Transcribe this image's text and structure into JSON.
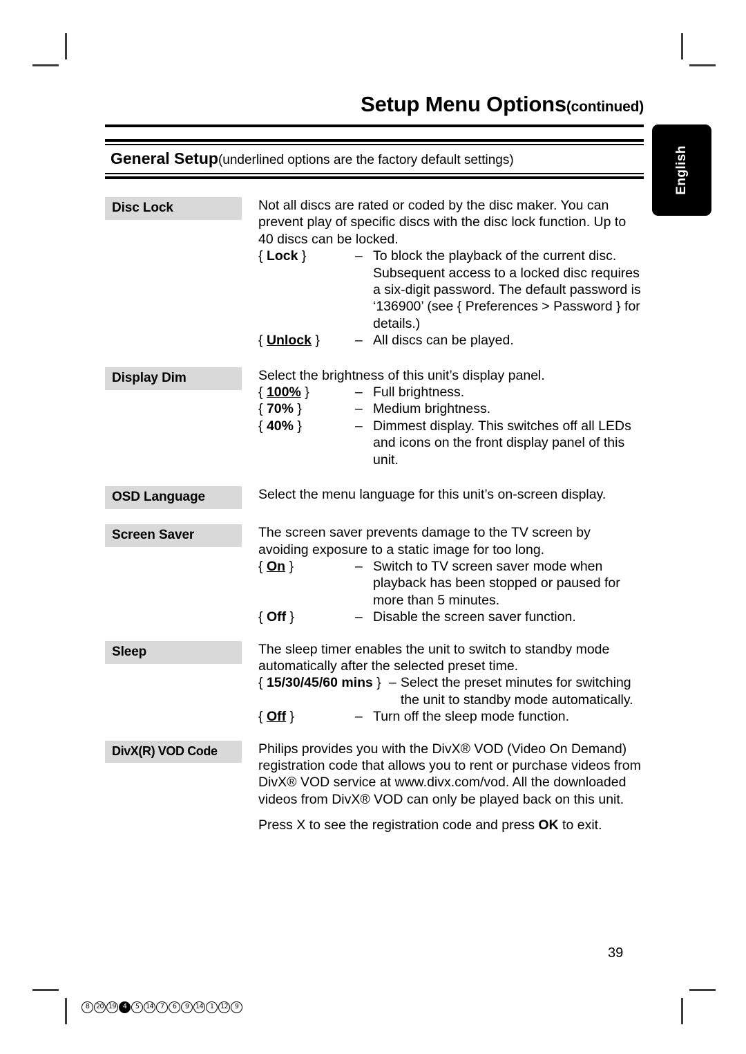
{
  "document": {
    "header_title": "Setup Menu Options",
    "header_continued": "(continued)",
    "section_name": "General Setup",
    "section_note": "(underlined options are the factory default settings)",
    "page_number": "39",
    "side_tab_label": "English"
  },
  "colors": {
    "term_background": "#d9d9d9",
    "rule": "#000000",
    "side_tab_background": "#000000",
    "side_tab_text": "#ffffff",
    "crop_mark": "#3b3b3b"
  },
  "entries": {
    "disc_lock": {
      "term": "Disc Lock",
      "intro": "Not all discs are rated or coded by the disc maker. You can prevent play of specific discs with the disc lock function. Up to 40 discs can be locked.",
      "options": [
        {
          "key_open": "{ ",
          "key": "Lock",
          "key_close": " }",
          "dash": "–",
          "text": "To block the playback of the current disc. Subsequent access to a locked disc requires a six-digit password.  The default password is ‘136900’ (see { Preferences > Password } for details.)"
        },
        {
          "key_open": "{ ",
          "key": "Unlock",
          "key_close": " }",
          "dash": "–",
          "text": "All discs can be played."
        }
      ]
    },
    "display_dim": {
      "term": "Display Dim",
      "intro": "Select the brightness of this unit’s display panel.",
      "options": [
        {
          "key_open": "{ ",
          "key": "100%",
          "key_close": " }",
          "dash": "–",
          "text": "Full brightness."
        },
        {
          "key_open": "{ ",
          "key": "70%",
          "key_close": " }",
          "dash": "–",
          "text": "Medium brightness."
        },
        {
          "key_open": "{ ",
          "key": "40%",
          "key_close": " }",
          "dash": "–",
          "text": "Dimmest display.  This switches off all LEDs and icons on the front display panel of this unit."
        }
      ]
    },
    "osd_language": {
      "term": "OSD Language",
      "intro": "Select the menu language for this unit’s on-screen display."
    },
    "screen_saver": {
      "term": "Screen Saver",
      "intro": "The screen saver prevents damage to the TV screen by avoiding exposure to a static image for too long.",
      "options": [
        {
          "key_open": "{ ",
          "key": "On",
          "key_close": " }",
          "dash": "–",
          "text": "Switch to TV screen saver mode when playback has been stopped or paused for more than 5 minutes."
        },
        {
          "key_open": "{ ",
          "key": "Off",
          "key_close": " }",
          "dash": "–",
          "text": "Disable the screen saver function."
        }
      ]
    },
    "sleep": {
      "term": "Sleep",
      "intro": "The sleep timer enables the unit to switch to standby mode automatically after the selected preset time.",
      "options": [
        {
          "key_open": "{ ",
          "key": "15/30/45/60 mins",
          "key_close": " }",
          "dash": "–",
          "text": "Select the preset minutes for switching the unit to standby mode automatically."
        },
        {
          "key_open": "{ ",
          "key": "Off",
          "key_close": " }",
          "dash": "–",
          "text": "Turn off the sleep mode function."
        }
      ]
    },
    "divx_vod": {
      "term": "DivX(R) VOD Code",
      "intro": "Philips provides you with the DivX® VOD (Video On Demand) registration code that allows you to rent or purchase videos from DivX® VOD service at www.divx.com/vod.  All the downloaded videos from DivX® VOD can only be played back on this unit.",
      "note_before": "Press  X to see the registration code and press ",
      "note_key": "OK",
      "note_after": " to exit."
    }
  },
  "footer_codes": [
    {
      "value": "8",
      "filled": false
    },
    {
      "value": "20",
      "filled": false
    },
    {
      "value": "19",
      "filled": false
    },
    {
      "value": "4",
      "filled": true
    },
    {
      "value": "5",
      "filled": false
    },
    {
      "value": "14",
      "filled": false
    },
    {
      "value": "7",
      "filled": false
    },
    {
      "value": "6",
      "filled": false
    },
    {
      "value": "9",
      "filled": false
    },
    {
      "value": "14",
      "filled": false
    },
    {
      "value": "1",
      "filled": false
    },
    {
      "value": "12",
      "filled": false
    },
    {
      "value": "9",
      "filled": false
    }
  ]
}
